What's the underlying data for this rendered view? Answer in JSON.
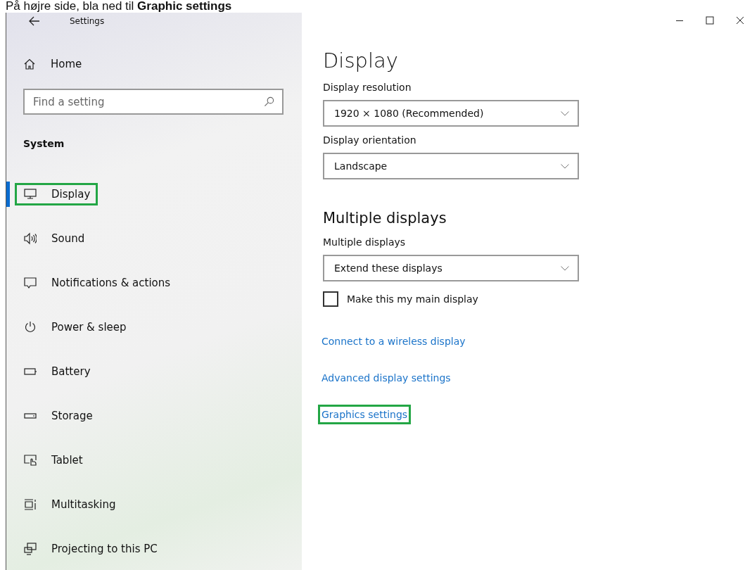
{
  "caption": {
    "text": "På højre side, bla ned til **Graphic settings**"
  },
  "window": {
    "title": "Settings"
  },
  "sidebar": {
    "home": "Home",
    "search": {
      "placeholder": "Find a setting"
    },
    "section": "System",
    "items": [
      {
        "label": "Display",
        "kind": "display",
        "selected": true,
        "annotated": true
      },
      {
        "label": "Sound",
        "kind": "sound",
        "selected": false,
        "annotated": false
      },
      {
        "label": "Notifications & actions",
        "kind": "notifications",
        "selected": false,
        "annotated": false
      },
      {
        "label": "Power & sleep",
        "kind": "power",
        "selected": false,
        "annotated": false
      },
      {
        "label": "Battery",
        "kind": "battery",
        "selected": false,
        "annotated": false
      },
      {
        "label": "Storage",
        "kind": "storage",
        "selected": false,
        "annotated": false
      },
      {
        "label": "Tablet",
        "kind": "tablet",
        "selected": false,
        "annotated": false
      },
      {
        "label": "Multitasking",
        "kind": "multitasking",
        "selected": false,
        "annotated": false
      },
      {
        "label": "Projecting to this PC",
        "kind": "projecting",
        "selected": false,
        "annotated": false
      }
    ]
  },
  "content": [
    {
      "kind": "heading",
      "text": "Display"
    },
    {
      "kind": "dropdown",
      "label": "Display resolution",
      "value": "1920 × 1080 (Recommended)"
    },
    {
      "kind": "dropdown",
      "label": "Display orientation",
      "value": "Landscape"
    },
    {
      "kind": "subheading",
      "text": "Multiple displays"
    },
    {
      "kind": "dropdown",
      "label": "Multiple displays",
      "value": "Extend these displays"
    },
    {
      "kind": "checkbox",
      "label": "Make this my main display",
      "checked": false
    },
    {
      "kind": "link",
      "text": "Connect to a wireless display",
      "annotated": false
    },
    {
      "kind": "link",
      "text": "Advanced display settings",
      "annotated": false
    },
    {
      "kind": "link",
      "text": "Graphics settings",
      "annotated": true
    }
  ]
}
